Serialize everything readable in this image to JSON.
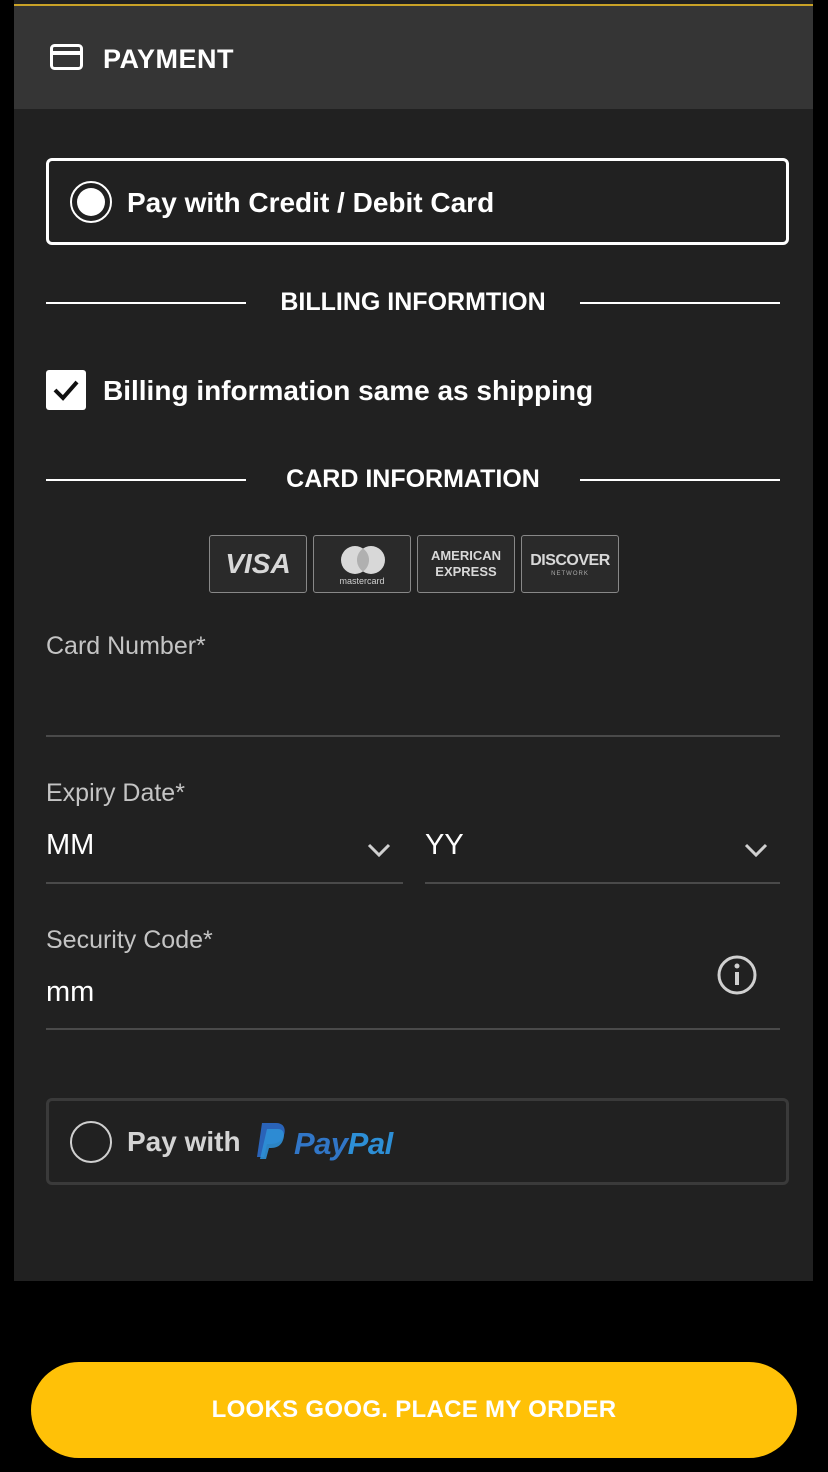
{
  "header": {
    "title": "PAYMENT",
    "icon": "credit-card-icon"
  },
  "payment_options": {
    "credit": {
      "label": "Pay with Credit / Debit Card",
      "selected": true
    },
    "paypal": {
      "label": "Pay with",
      "brand_pay": "Pay",
      "brand_pal": "Pal",
      "selected": false
    }
  },
  "billing": {
    "section_title": "BILLING INFORMTION",
    "same_as_shipping_label": "Billing information same as shipping",
    "same_as_shipping_checked": true
  },
  "card": {
    "section_title": "CARD INFORMATION",
    "logos": {
      "visa": "VISA",
      "mastercard": "mastercard",
      "amex_line1": "AMERICAN",
      "amex_line2": "EXPRESS",
      "discover": "DISCOVER",
      "discover_sub": "NETWORK"
    },
    "card_number_label": "Card Number*",
    "card_number_value": "",
    "expiry_label": "Expiry Date*",
    "expiry_month": "MM",
    "expiry_year": "YY",
    "security_label": "Security Code*",
    "security_value": "mm"
  },
  "order_button_label": "LOOKS GOOG. PLACE MY ORDER",
  "colors": {
    "accent": "#ffc107",
    "panel": "#212121",
    "header": "#353535",
    "paypal_blue": "#2d8fd6"
  }
}
